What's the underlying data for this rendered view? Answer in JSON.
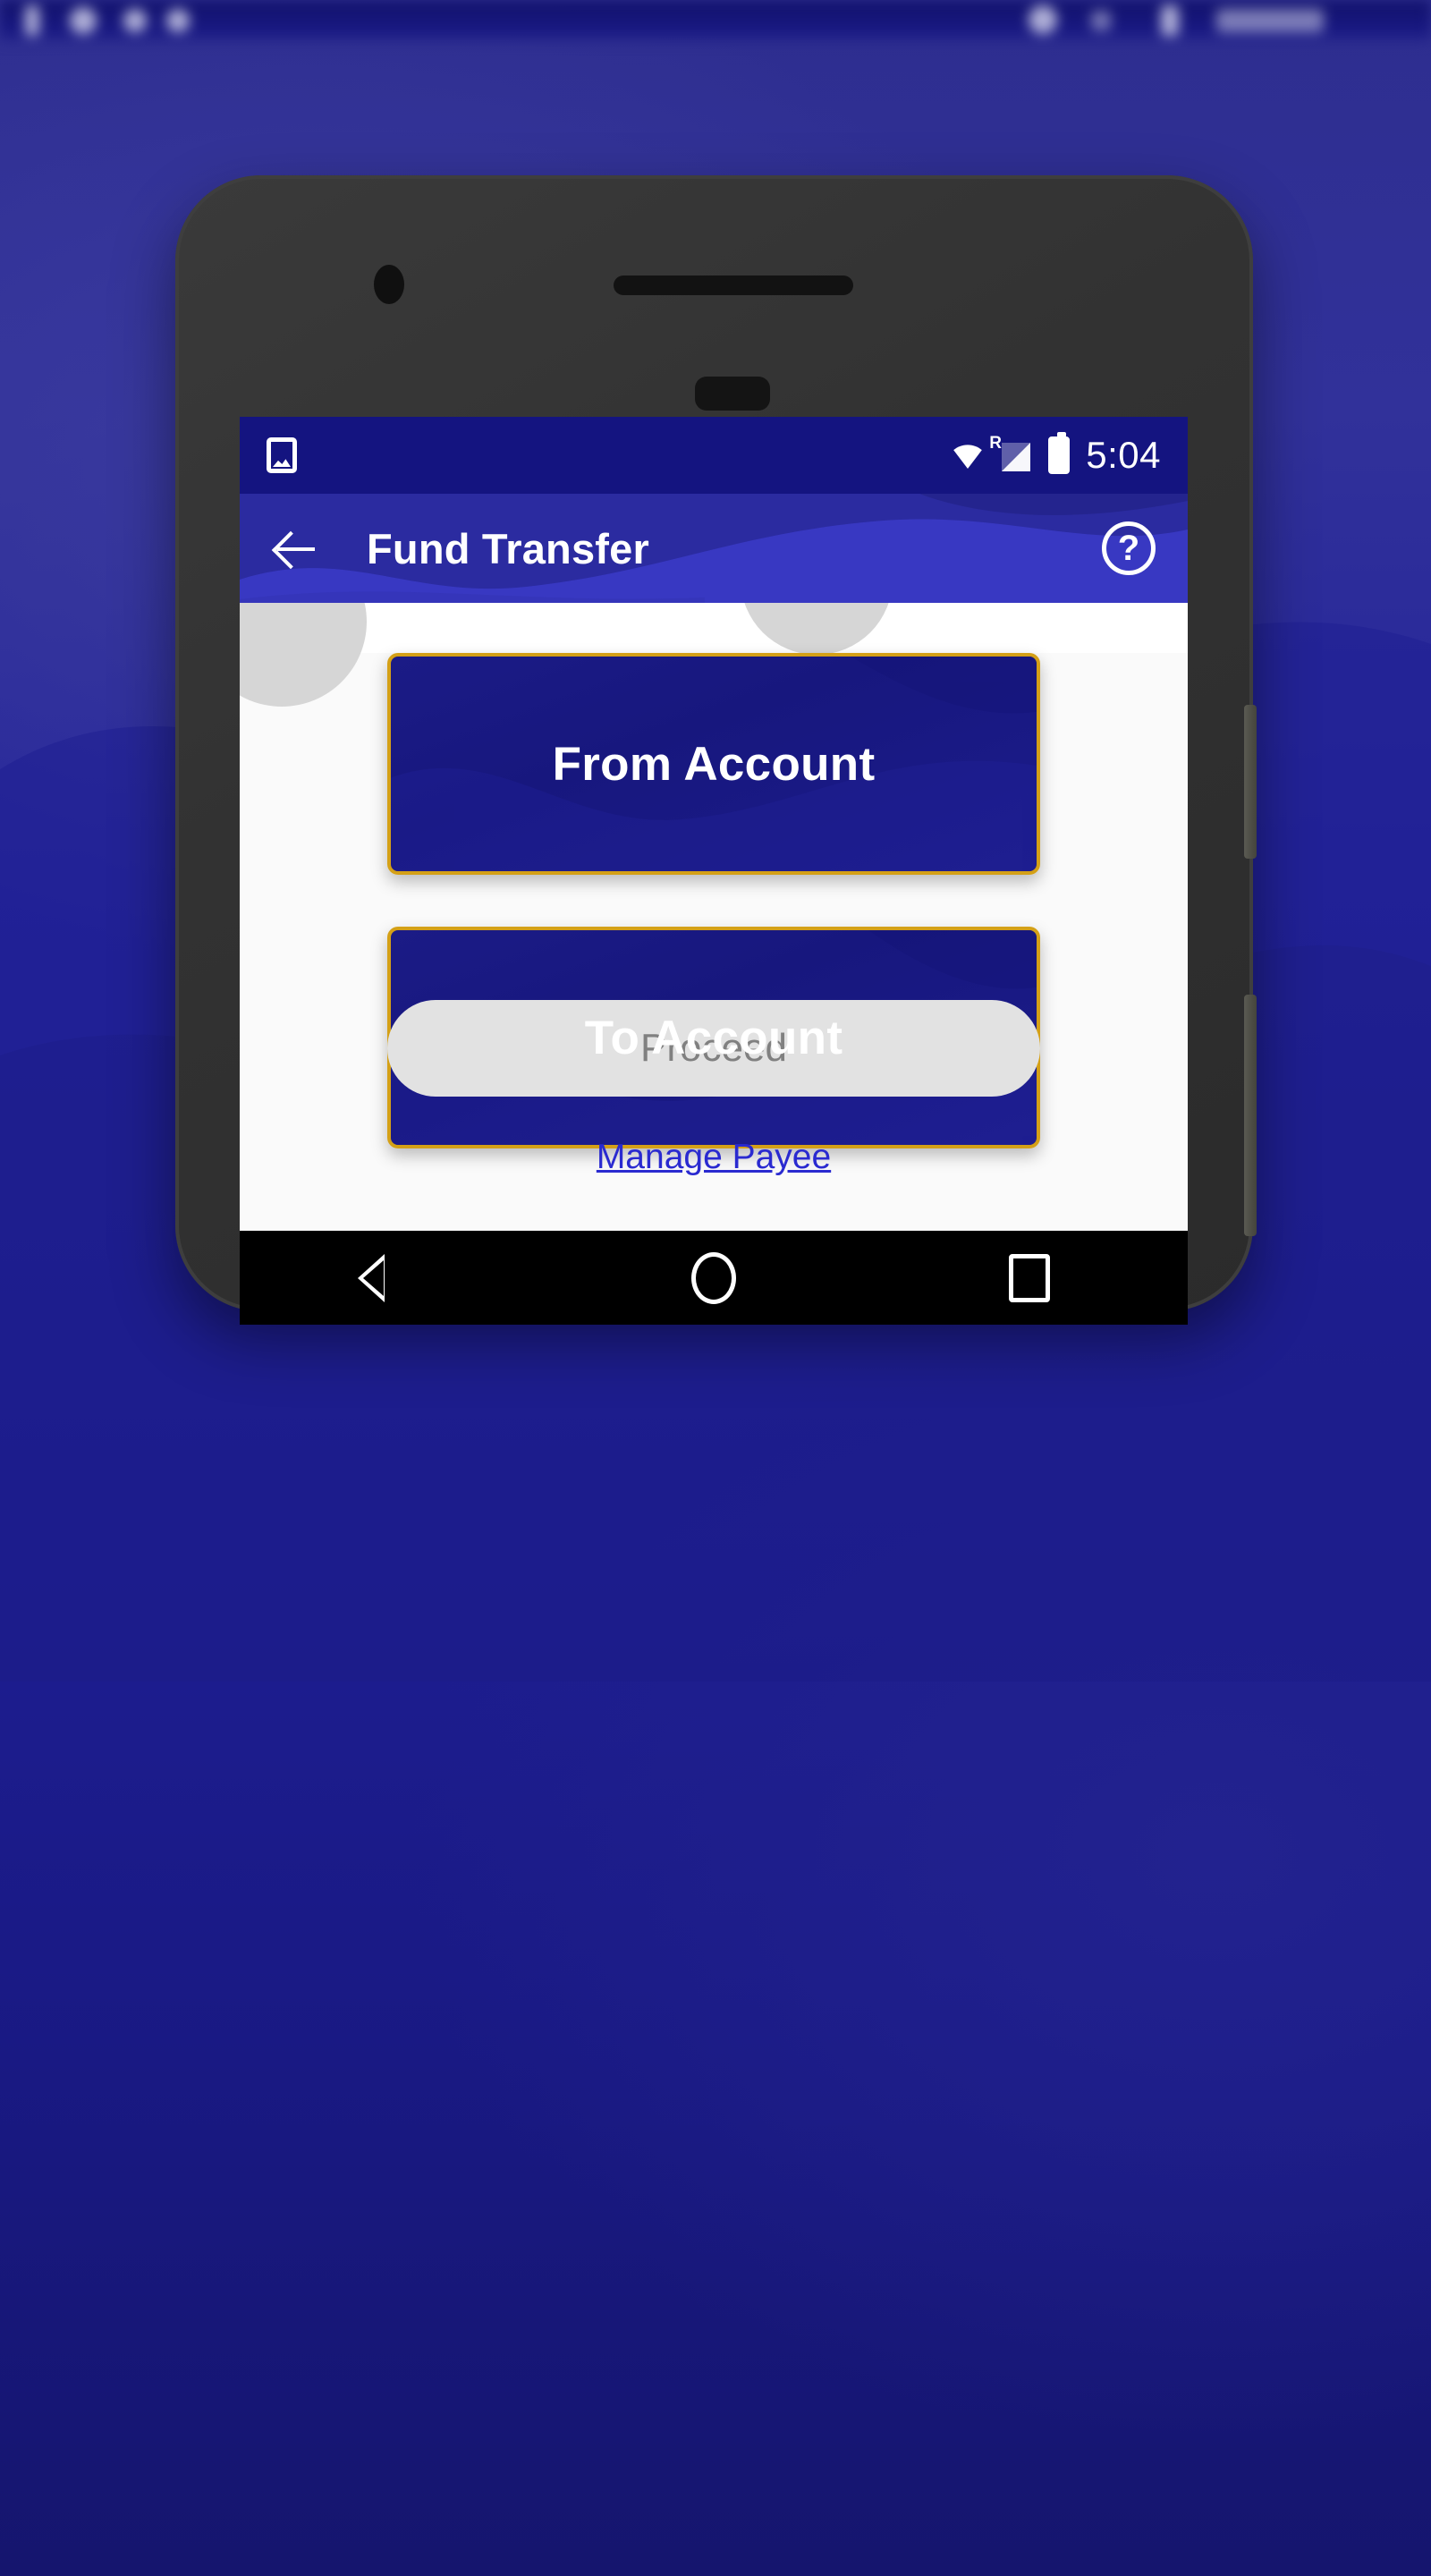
{
  "desktop": {
    "status_bar": {
      "description": "blurred-os-status-bar",
      "background_color": "#171780"
    },
    "background_color": "#24249a"
  },
  "device": {
    "frame_color": "#323232",
    "side_buttons": [
      "power",
      "volume"
    ]
  },
  "phone_status_bar": {
    "icons": [
      "photo-icon",
      "wifi-icon",
      "signal-roaming-icon",
      "battery-icon"
    ],
    "roaming_label": "R",
    "time": "5:04",
    "background_color": "#141480"
  },
  "appbar": {
    "back_label": "back-arrow",
    "title": "Fund Transfer",
    "help_label": "?",
    "background_color": "#2b2ba0",
    "wave_color": "#3b3bc8"
  },
  "screen": {
    "background_color": "#fafafa",
    "cards": [
      {
        "label": "From Account",
        "fill": "#1b1b86",
        "border": "#d4a017"
      },
      {
        "label": "To Account",
        "fill": "#1b1b86",
        "border": "#d4a017"
      }
    ],
    "proceed": {
      "label": "Proceed",
      "enabled": false,
      "background_color": "#e2e2e2",
      "text_color": "#808080"
    },
    "manage_payee": {
      "label": "Manage Payee",
      "color": "#2a2ad0"
    }
  },
  "nav_bar": {
    "items": [
      "back",
      "home",
      "recents"
    ],
    "background_color": "#000000"
  }
}
